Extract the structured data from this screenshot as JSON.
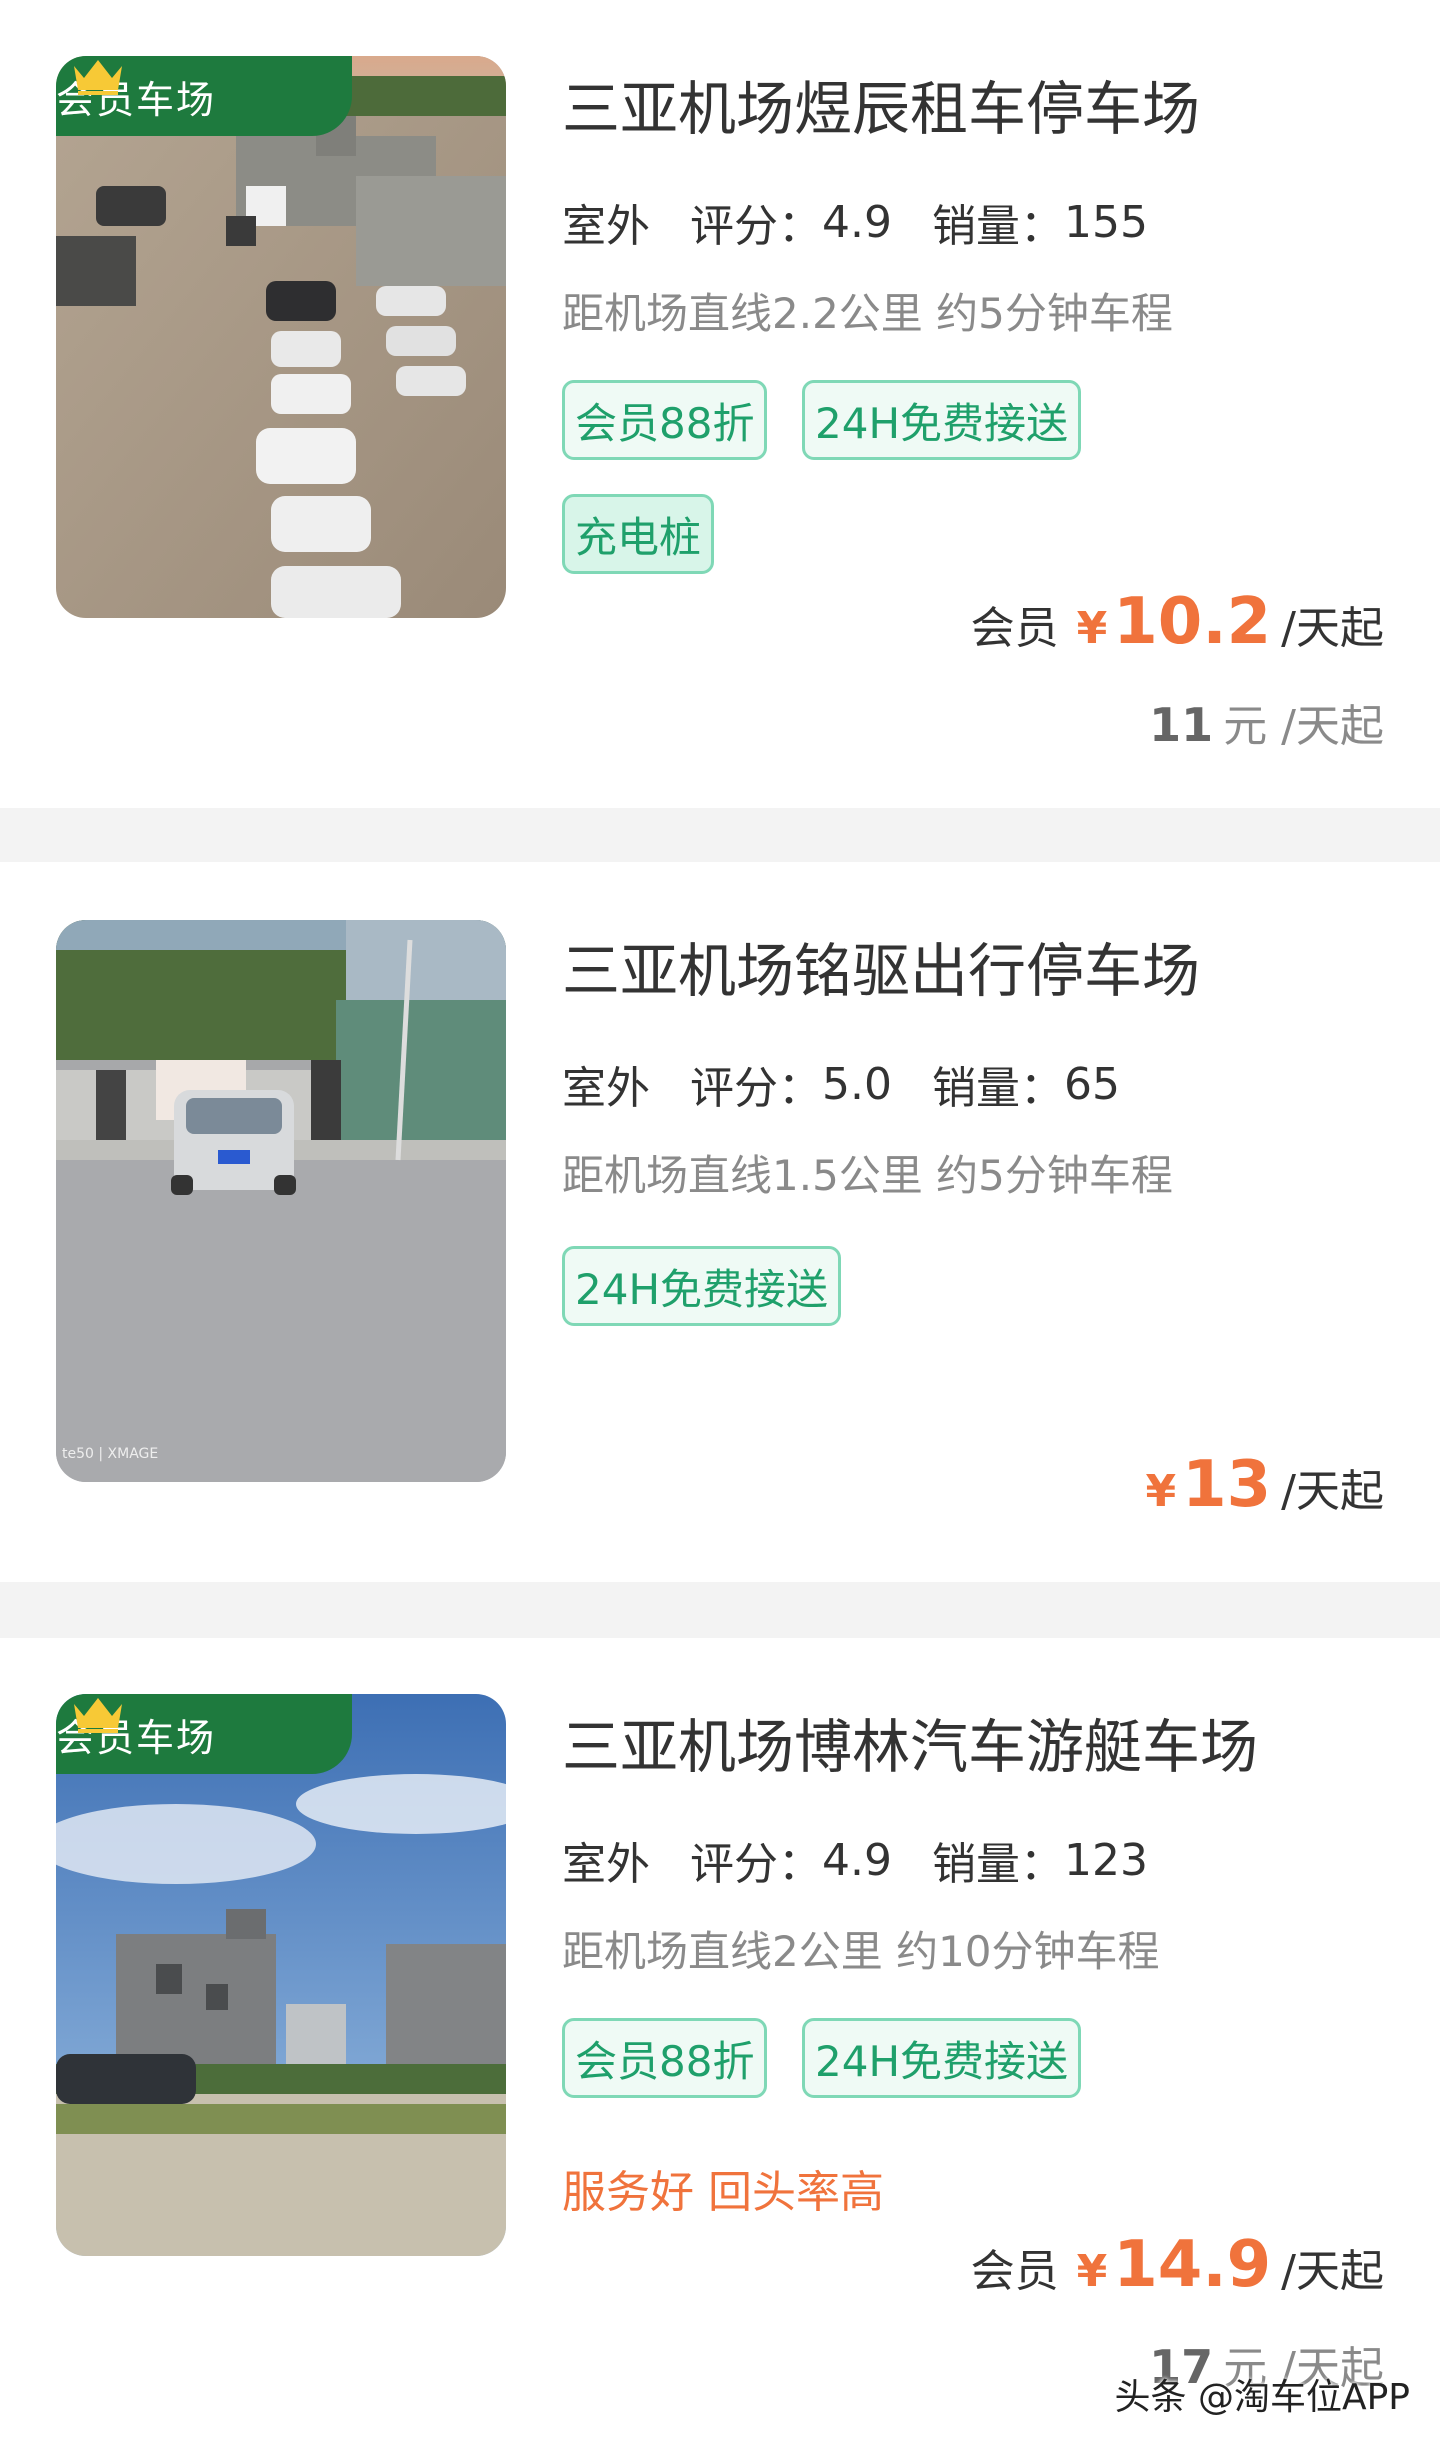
{
  "colors": {
    "accent_green": "#1fa06b",
    "badge_green": "#1e7a3e",
    "price_orange": "#f0733c"
  },
  "listings": [
    {
      "member_badge": "会员车场",
      "member_badge_icon": "crown-icon",
      "name": "三亚机场煜辰租车停车场",
      "type": "室外",
      "rating_label": "评分：",
      "rating": "4.9",
      "sales_label": "销量：",
      "sales": "155",
      "distance": "距机场直线2.2公里 约5分钟车程",
      "tags": [
        "会员88折",
        "24H免费接送",
        "充电桩"
      ],
      "member_price_label": "会员",
      "currency": "¥",
      "price": "10.2",
      "price_unit": "/天起",
      "original_price": "11",
      "original_unit": "元 /天起"
    },
    {
      "name": "三亚机场铭驱出行停车场",
      "type": "室外",
      "rating_label": "评分：",
      "rating": "5.0",
      "sales_label": "销量：",
      "sales": "65",
      "distance": "距机场直线1.5公里 约5分钟车程",
      "tags": [
        "24H免费接送"
      ],
      "currency": "¥",
      "price": "13",
      "price_unit": "/天起",
      "photo_watermark": "te50 | XMAGE"
    },
    {
      "member_badge": "会员车场",
      "member_badge_icon": "crown-icon",
      "name": "三亚机场博林汽车游艇车场",
      "type": "室外",
      "rating_label": "评分：",
      "rating": "4.9",
      "sales_label": "销量：",
      "sales": "123",
      "distance": "距机场直线2公里 约10分钟车程",
      "tags": [
        "会员88折",
        "24H免费接送"
      ],
      "promo": "服务好 回头率高",
      "member_price_label": "会员",
      "currency": "¥",
      "price": "14.9",
      "price_unit": "/天起",
      "original_price": "17",
      "original_unit": "元 /天起"
    }
  ],
  "watermark": "头条 @淘车位APP"
}
